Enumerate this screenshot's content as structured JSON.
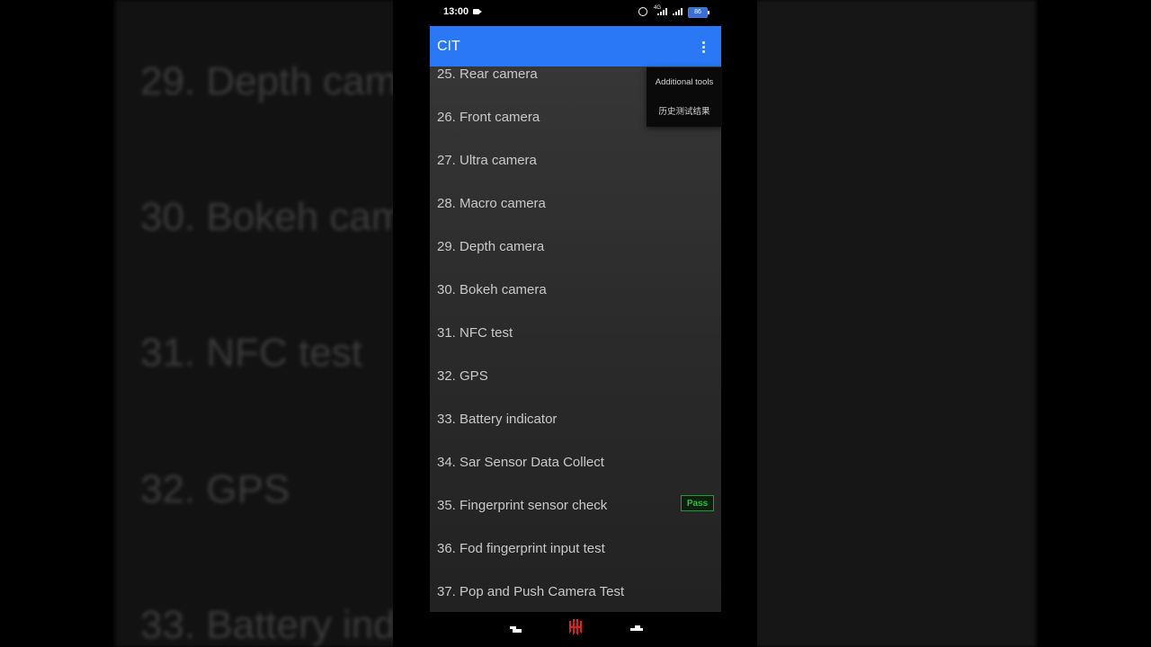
{
  "status_bar": {
    "time": "13:00",
    "network_label": "4G",
    "battery_level": "86"
  },
  "app_bar": {
    "title": "CIT"
  },
  "overflow_menu": {
    "items": [
      {
        "label": "Additional tools"
      },
      {
        "label": "历史测试结果"
      }
    ]
  },
  "test_list": {
    "items": [
      {
        "label": "25. Rear camera",
        "status": ""
      },
      {
        "label": "26. Front camera",
        "status": ""
      },
      {
        "label": "27. Ultra camera",
        "status": ""
      },
      {
        "label": "28. Macro camera",
        "status": ""
      },
      {
        "label": "29. Depth camera",
        "status": ""
      },
      {
        "label": "30. Bokeh camera",
        "status": ""
      },
      {
        "label": "31. NFC test",
        "status": ""
      },
      {
        "label": "32. GPS",
        "status": ""
      },
      {
        "label": "33. Battery indicator",
        "status": ""
      },
      {
        "label": "34. Sar Sensor Data Collect",
        "status": ""
      },
      {
        "label": "35. Fingerprint sensor check",
        "status": "Pass"
      },
      {
        "label": "36. Fod fingerprint input test",
        "status": ""
      },
      {
        "label": "37. Pop and Push Camera Test",
        "status": ""
      }
    ]
  },
  "background_blur": {
    "items": [
      {
        "label": "29. Depth cam"
      },
      {
        "label": "30. Bokeh cam"
      },
      {
        "label": "31. NFC test"
      },
      {
        "label": "32. GPS"
      },
      {
        "label": "33. Battery ind"
      }
    ]
  },
  "colors": {
    "app_bar": "#2a78f5",
    "pass_green": "#22c23a",
    "nav_home_red": "#e0201c"
  },
  "icons": {
    "status": [
      "video-camera-icon",
      "alarm-icon",
      "signal-icon",
      "battery-icon"
    ],
    "nav": [
      "recent-apps-icon",
      "home-logo-icon",
      "back-icon"
    ],
    "app_bar": [
      "overflow-menu-icon"
    ]
  }
}
